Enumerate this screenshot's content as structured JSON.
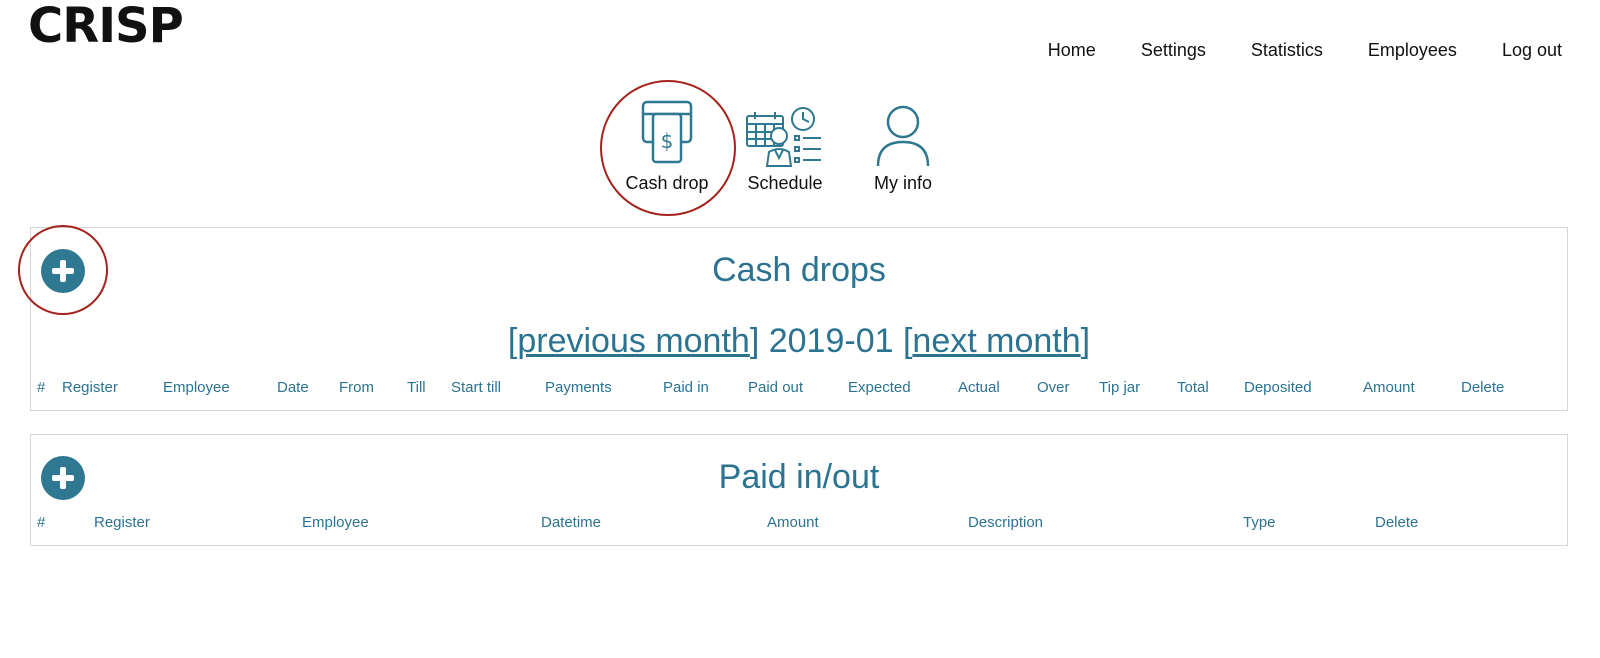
{
  "brand": {
    "logo": "CRISP"
  },
  "nav": {
    "home": "Home",
    "settings": "Settings",
    "statistics": "Statistics",
    "employees": "Employees",
    "logout": "Log out"
  },
  "modules": {
    "cash_drop": {
      "label": "Cash drop",
      "icon": "atm-cash-icon"
    },
    "schedule": {
      "label": "Schedule",
      "icon": "schedule-icon"
    },
    "my_info": {
      "label": "My info",
      "icon": "user-icon"
    }
  },
  "cash_drops": {
    "title": "Cash drops",
    "prev_month": "previous month",
    "next_month": "next month",
    "current_month": "2019-01",
    "columns": [
      "#",
      "Register",
      "Employee",
      "Date",
      "From",
      "Till",
      "Start till",
      "Payments",
      "Paid in",
      "Paid out",
      "Expected",
      "Actual",
      "Over",
      "Tip jar",
      "Total",
      "Deposited",
      "Amount",
      "Delete"
    ]
  },
  "paid_in_out": {
    "title": "Paid in/out",
    "columns": [
      "#",
      "Register",
      "Employee",
      "Datetime",
      "Amount",
      "Description",
      "Type",
      "Delete"
    ]
  },
  "colors": {
    "accent": "#2b7391",
    "button": "#2f7891",
    "highlight_ring": "#a3241c",
    "border": "#d6d6d6"
  }
}
